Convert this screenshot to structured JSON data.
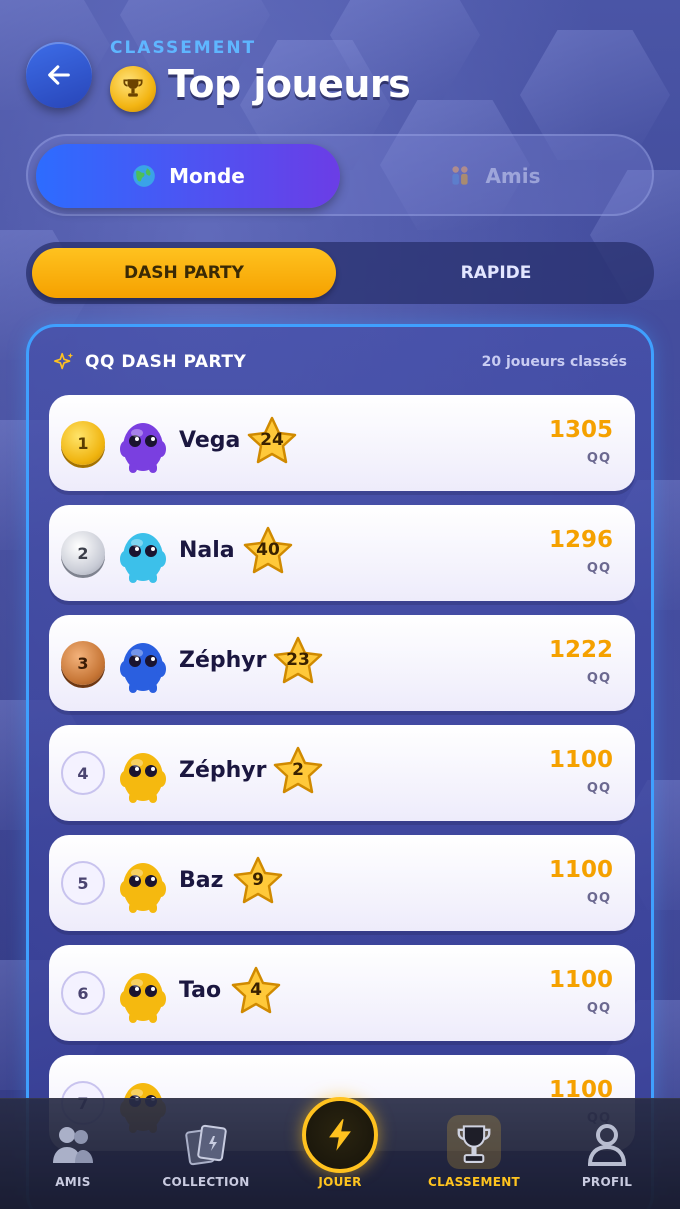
{
  "header": {
    "eyebrow": "CLASSEMENT",
    "title": "Top joueurs",
    "back_icon": "arrow-left-icon",
    "trophy_icon": "trophy-icon"
  },
  "scope_tabs": [
    {
      "label": "Monde",
      "icon": "globe-icon",
      "active": true
    },
    {
      "label": "Amis",
      "icon": "friends-icon",
      "active": false
    }
  ],
  "mode_tabs": [
    {
      "label": "DASH PARTY",
      "active": true
    },
    {
      "label": "RAPIDE",
      "active": false
    }
  ],
  "panel": {
    "title": "QQ DASH PARTY",
    "icon": "sparkle-icon",
    "count": "20 joueurs classés"
  },
  "players": [
    {
      "rank": "1",
      "name": "Vega",
      "level": "24",
      "score": "1305",
      "unit": "QQ",
      "color": "#7a3fe0"
    },
    {
      "rank": "2",
      "name": "Nala",
      "level": "40",
      "score": "1296",
      "unit": "QQ",
      "color": "#3cc0ea"
    },
    {
      "rank": "3",
      "name": "Zéphyr",
      "level": "23",
      "score": "1222",
      "unit": "QQ",
      "color": "#2a5fe0"
    },
    {
      "rank": "4",
      "name": "Zéphyr",
      "level": "2",
      "score": "1100",
      "unit": "QQ",
      "color": "#f5b90f"
    },
    {
      "rank": "5",
      "name": "Baz",
      "level": "9",
      "score": "1100",
      "unit": "QQ",
      "color": "#f5b90f"
    },
    {
      "rank": "6",
      "name": "Tao",
      "level": "4",
      "score": "1100",
      "unit": "QQ",
      "color": "#f5b90f"
    },
    {
      "rank": "7",
      "name": "",
      "level": "",
      "score": "1100",
      "unit": "QQ",
      "color": "#f5b90f"
    }
  ],
  "nav": [
    {
      "label": "AMIS",
      "icon": "friends-icon",
      "active": false
    },
    {
      "label": "COLLECTION",
      "icon": "cards-icon",
      "active": false
    },
    {
      "label": "JOUER",
      "icon": "lightning-icon",
      "active": true
    },
    {
      "label": "CLASSEMENT",
      "icon": "trophy-icon",
      "active": true
    },
    {
      "label": "PROFIL",
      "icon": "user-icon",
      "active": false
    }
  ],
  "colors": {
    "accent": "#3fa0ff",
    "gold": "#f5a100",
    "primary": "#2d6cff"
  }
}
